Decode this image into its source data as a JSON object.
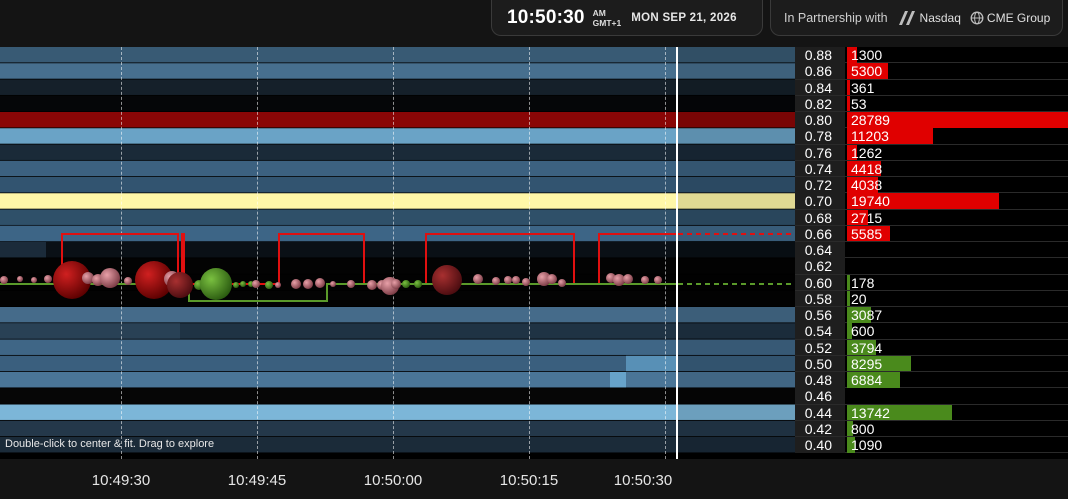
{
  "header": {
    "time": "10:50:30",
    "ampm": "AM",
    "timezone": "GMT+1",
    "date": "MON SEP 21, 2026",
    "partnership_label": "In Partnership with",
    "partner_1": "Nasdaq",
    "partner_2": "CME Group"
  },
  "hint": "Double-click to center & fit. Drag to explore",
  "x_labels": [
    "10:49:30",
    "10:49:45",
    "10:50:00",
    "10:50:15",
    "10:50:30"
  ],
  "colors": {
    "ask": "#e00000",
    "bid": "#4a8a1c",
    "highlight": "#fff7a8",
    "heat": "#5fa0c8"
  },
  "ladder": [
    {
      "price": "0.88",
      "qty": "1300",
      "side": "ask",
      "qty_num": 1300
    },
    {
      "price": "0.86",
      "qty": "5300",
      "side": "ask",
      "qty_num": 5300
    },
    {
      "price": "0.84",
      "qty": "361",
      "side": "ask",
      "qty_num": 361
    },
    {
      "price": "0.82",
      "qty": "53",
      "side": "ask",
      "qty_num": 53
    },
    {
      "price": "0.80",
      "qty": "28789",
      "side": "ask",
      "qty_num": 28789
    },
    {
      "price": "0.78",
      "qty": "11203",
      "side": "ask",
      "qty_num": 11203
    },
    {
      "price": "0.76",
      "qty": "1262",
      "side": "ask",
      "qty_num": 1262
    },
    {
      "price": "0.74",
      "qty": "4418",
      "side": "ask",
      "qty_num": 4418
    },
    {
      "price": "0.72",
      "qty": "4038",
      "side": "ask",
      "qty_num": 4038
    },
    {
      "price": "0.70",
      "qty": "19740",
      "side": "ask",
      "qty_num": 19740
    },
    {
      "price": "0.68",
      "qty": "2715",
      "side": "ask",
      "qty_num": 2715
    },
    {
      "price": "0.66",
      "qty": "5585",
      "side": "ask",
      "qty_num": 5585
    },
    {
      "price": "0.64",
      "qty": "",
      "side": "none",
      "qty_num": 0
    },
    {
      "price": "0.62",
      "qty": "",
      "side": "none",
      "qty_num": 0
    },
    {
      "price": "0.60",
      "qty": "178",
      "side": "bid",
      "qty_num": 178
    },
    {
      "price": "0.58",
      "qty": "20",
      "side": "bid",
      "qty_num": 20
    },
    {
      "price": "0.56",
      "qty": "3087",
      "side": "bid",
      "qty_num": 3087
    },
    {
      "price": "0.54",
      "qty": "600",
      "side": "bid",
      "qty_num": 600
    },
    {
      "price": "0.52",
      "qty": "3794",
      "side": "bid",
      "qty_num": 3794
    },
    {
      "price": "0.50",
      "qty": "8295",
      "side": "bid",
      "qty_num": 8295
    },
    {
      "price": "0.48",
      "qty": "6884",
      "side": "bid",
      "qty_num": 6884
    },
    {
      "price": "0.46",
      "qty": "",
      "side": "none",
      "qty_num": 0
    },
    {
      "price": "0.44",
      "qty": "13742",
      "side": "bid",
      "qty_num": 13742
    },
    {
      "price": "0.42",
      "qty": "800",
      "side": "bid",
      "qty_num": 800
    },
    {
      "price": "0.40",
      "qty": "1090",
      "side": "bid",
      "qty_num": 1090
    }
  ]
}
